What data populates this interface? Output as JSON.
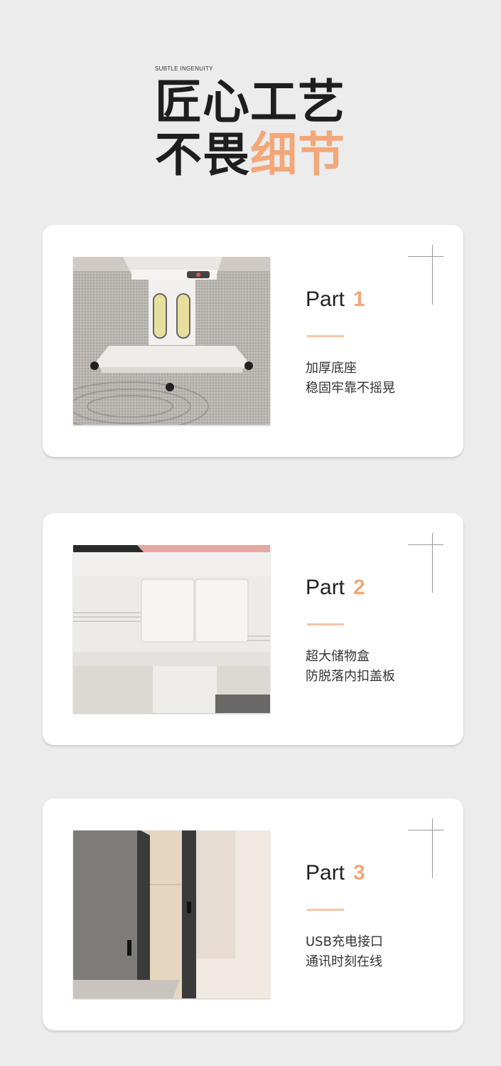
{
  "header": {
    "subtitle": "SUBTLE INGENUITY",
    "line1": "匠心工艺",
    "line2_plain": "不畏",
    "line2_accent": "细节"
  },
  "colors": {
    "accent": "#f3a779",
    "accent_bar": "#f8c5a6",
    "background": "#ececec",
    "card": "#ffffff"
  },
  "parts": [
    {
      "label": "Part",
      "number": "1",
      "desc_line1": "加厚底座",
      "desc_line2": "稳固牢靠不摇晃",
      "image": "table-pedestal-base-photo"
    },
    {
      "label": "Part",
      "number": "2",
      "desc_line1": "超大储物盒",
      "desc_line2": "防脱落内扣盖板",
      "image": "storage-drawer-photo"
    },
    {
      "label": "Part",
      "number": "3",
      "desc_line1": "USB充电接口",
      "desc_line2": "通讯时刻在线",
      "image": "usb-port-photo"
    }
  ]
}
